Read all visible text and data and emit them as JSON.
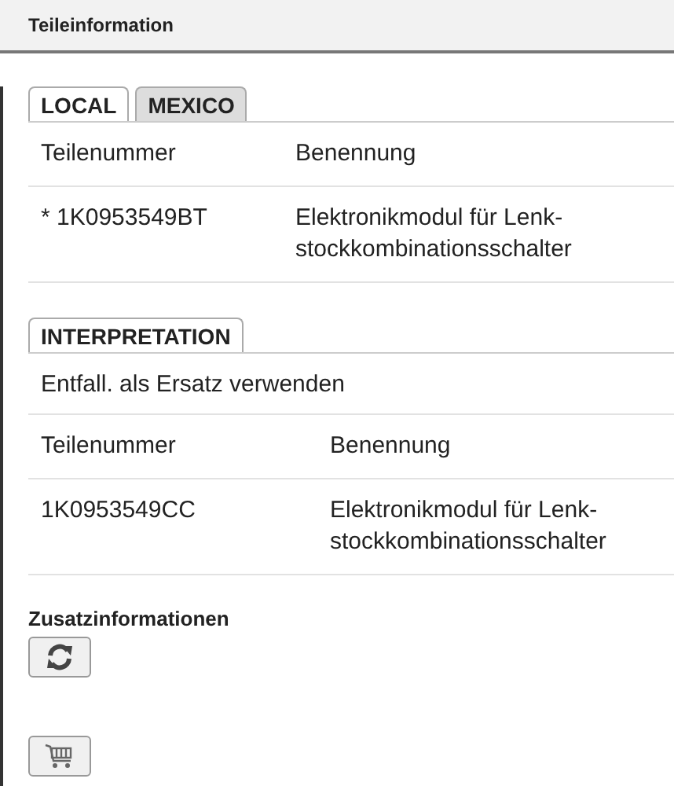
{
  "header": {
    "title": "Teileinformation"
  },
  "tabs": [
    {
      "label": "LOCAL",
      "selected": true
    },
    {
      "label": "MEXICO",
      "selected": false
    }
  ],
  "parts_table": {
    "columns": [
      "Teilenummer",
      "Benennung"
    ],
    "rows": [
      [
        "* 1K0953549BT",
        "Elektronikmodul für Lenk-\nstockkombinationsschalter"
      ]
    ]
  },
  "interpretation_tabs": [
    {
      "label": "INTERPRETATION",
      "selected": true
    }
  ],
  "interpretation_note": "Entfall. als Ersatz verwenden",
  "interpretation_table": {
    "columns": [
      "Teilenummer",
      "Benennung"
    ],
    "rows": [
      [
        "1K0953549CC",
        "Elektronikmodul für Lenk-\nstockkombinationsschalter"
      ]
    ]
  },
  "additional_info": {
    "title": "Zusatzinformationen"
  }
}
